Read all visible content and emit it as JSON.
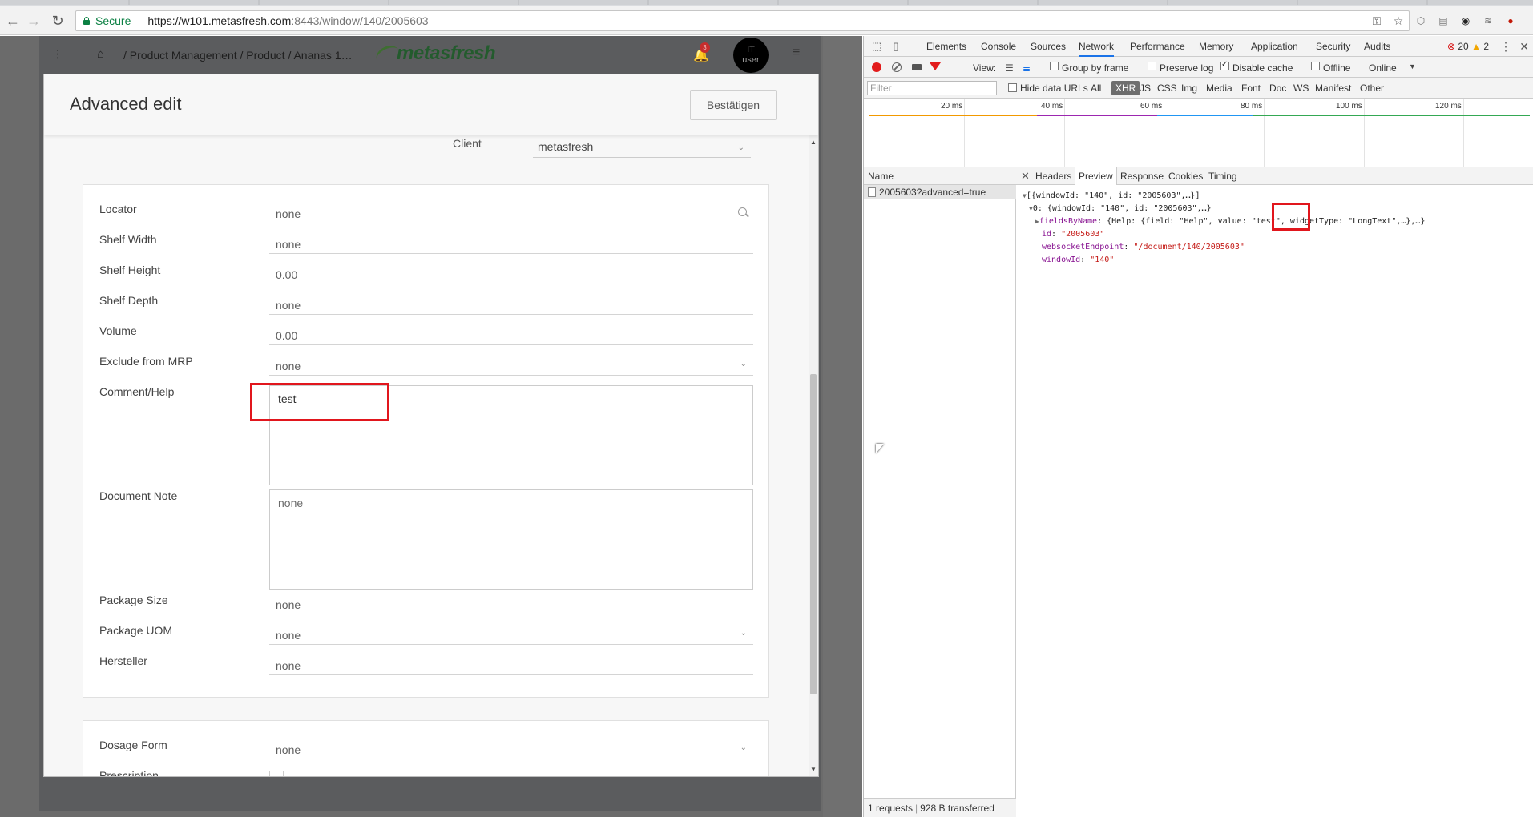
{
  "browser": {
    "secure_label": "Secure",
    "url_host": "https://w101.metasfresh.com",
    "url_path": ":8443/window/140/2005603"
  },
  "app": {
    "breadcrumb": "/  Product Management  /  Product  /  Ananas 1…",
    "logo_text": "metasfresh",
    "notification_count": "3",
    "avatar_line1": "IT",
    "avatar_line2": "user"
  },
  "modal": {
    "title": "Advanced edit",
    "confirm_label": "Bestätigen",
    "client": {
      "label": "Client",
      "value": "metasfresh"
    },
    "fields": {
      "locator": {
        "label": "Locator",
        "value": "none"
      },
      "shelf_width": {
        "label": "Shelf Width",
        "value": "none"
      },
      "shelf_height": {
        "label": "Shelf Height",
        "value": "0.00"
      },
      "shelf_depth": {
        "label": "Shelf Depth",
        "value": "none"
      },
      "volume": {
        "label": "Volume",
        "value": "0.00"
      },
      "exclude_mrp": {
        "label": "Exclude from MRP",
        "value": "none"
      },
      "comment_help": {
        "label": "Comment/Help",
        "value": "test"
      },
      "document_note": {
        "label": "Document Note",
        "value": "none"
      },
      "package_size": {
        "label": "Package Size",
        "value": "none"
      },
      "package_uom": {
        "label": "Package UOM",
        "value": "none"
      },
      "hersteller": {
        "label": "Hersteller",
        "value": "none"
      },
      "dosage_form": {
        "label": "Dosage Form",
        "value": "none"
      },
      "prescription": {
        "label": "Prescription"
      }
    }
  },
  "devtools": {
    "tabs": [
      "Elements",
      "Console",
      "Sources",
      "Network",
      "Performance",
      "Memory",
      "Application",
      "Security",
      "Audits"
    ],
    "active_tab": "Network",
    "error_count": "20",
    "warning_count": "2",
    "toolbar": {
      "view_label": "View:",
      "group_by_frame": "Group by frame",
      "preserve_log": "Preserve log",
      "disable_cache": "Disable cache",
      "offline": "Offline",
      "throttle": "Online"
    },
    "filter": {
      "placeholder": "Filter",
      "hide_data_urls": "Hide data URLs",
      "types": [
        "All",
        "XHR",
        "JS",
        "CSS",
        "Img",
        "Media",
        "Font",
        "Doc",
        "WS",
        "Manifest",
        "Other"
      ],
      "active_type": "XHR"
    },
    "timeline_ticks": [
      "20 ms",
      "40 ms",
      "60 ms",
      "80 ms",
      "100 ms",
      "120 ms"
    ],
    "name_header": "Name",
    "request_name": "2005603?advanced=true",
    "detail_tabs": [
      "Headers",
      "Preview",
      "Response",
      "Cookies",
      "Timing"
    ],
    "active_detail_tab": "Preview",
    "json_preview": {
      "line1": "[{windowId: \"140\", id: \"2005603\",…}]",
      "line2": "0: {windowId: \"140\", id: \"2005603\",…}",
      "line3_key": "fieldsByName",
      "line3_pre": ": {Help: {field: \"Help\", value: ",
      "line3_value": "\"test\"",
      "line3_post": ", widgetType: \"LongText\",…},…}",
      "id_key": "id",
      "id_value": "\"2005603\"",
      "ws_key": "websocketEndpoint",
      "ws_value": "\"/document/140/2005603\"",
      "window_key": "windowId",
      "window_value": "\"140\""
    },
    "status": {
      "requests": "1 requests",
      "transferred": "928 B transferred"
    }
  },
  "colors": {
    "highlight": "#e1161d",
    "secure_green": "#0b8043",
    "record_red": "#e21b1b"
  }
}
